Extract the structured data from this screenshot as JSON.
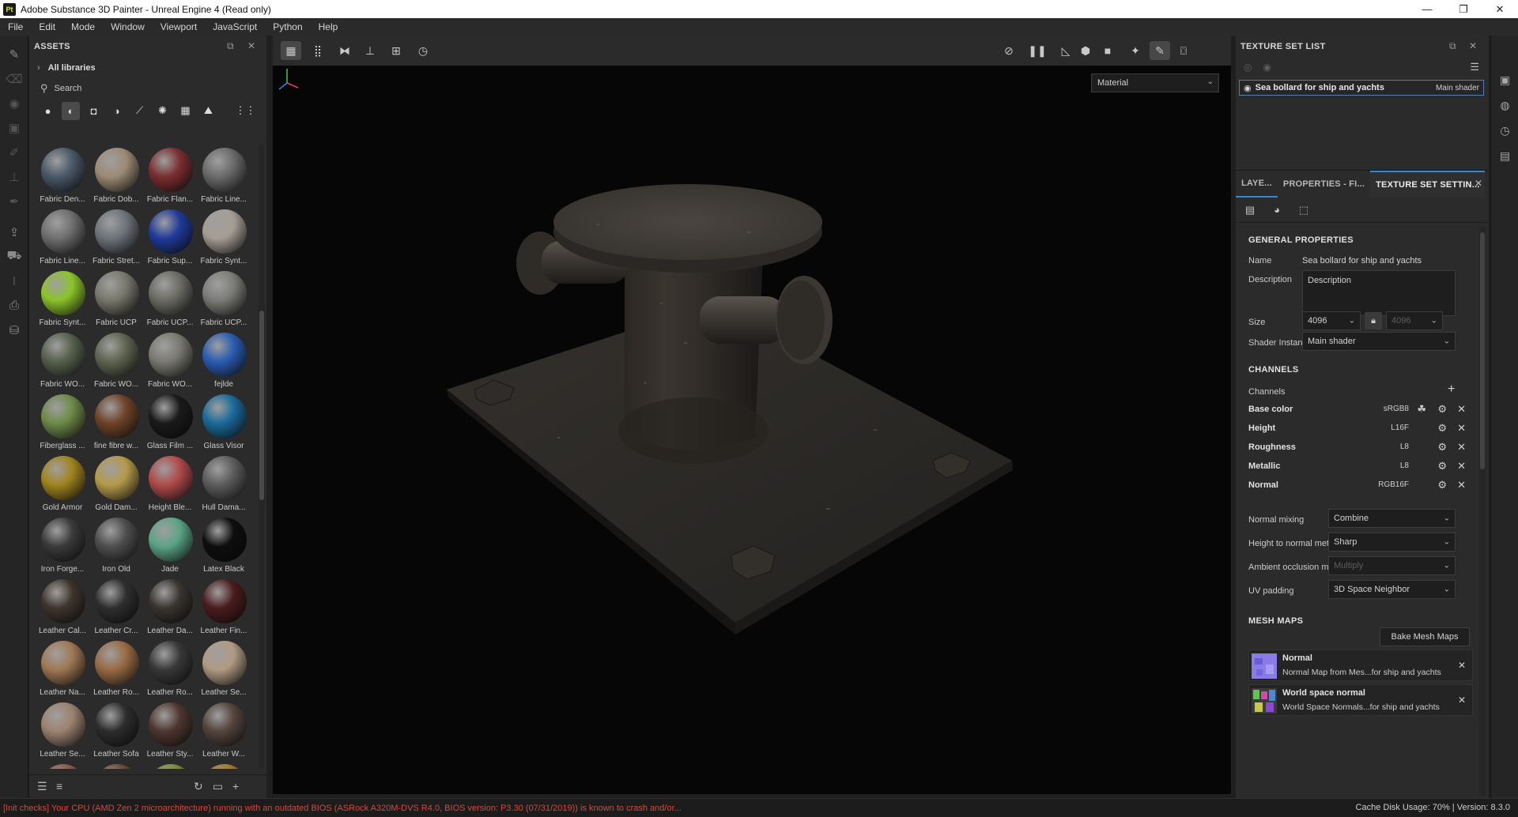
{
  "window": {
    "app_icon_text": "Pt",
    "title": "Adobe Substance 3D Painter - Unreal Engine 4 (Read only)",
    "controls": [
      "—",
      "❐",
      "✕"
    ]
  },
  "menu": [
    "File",
    "Edit",
    "Mode",
    "Window",
    "Viewport",
    "JavaScript",
    "Python",
    "Help"
  ],
  "assets": {
    "header": "ASSETS",
    "library": "All libraries",
    "search_placeholder": "Search",
    "tiles": [
      {
        "label": "Fabric Den...",
        "color": "#4a5868"
      },
      {
        "label": "Fabric Dob...",
        "color": "#9c8a74"
      },
      {
        "label": "Fabric Flan...",
        "color": "#7a2e30"
      },
      {
        "label": "Fabric Line...",
        "color": "#6a6a6a"
      },
      {
        "label": "Fabric Line...",
        "color": "#6f6f6f"
      },
      {
        "label": "Fabric Stret...",
        "color": "#6d737a"
      },
      {
        "label": "Fabric Sup...",
        "color": "#203a9a"
      },
      {
        "label": "Fabric Synt...",
        "color": "#a49d94"
      },
      {
        "label": "Fabric Synt...",
        "color": "#8bc42a"
      },
      {
        "label": "Fabric UCP",
        "color": "#78786c"
      },
      {
        "label": "Fabric UCP...",
        "color": "#6c6c64"
      },
      {
        "label": "Fabric UCP...",
        "color": "#7c7c78"
      },
      {
        "label": "Fabric WO...",
        "color": "#56604c"
      },
      {
        "label": "Fabric WO...",
        "color": "#5e6450"
      },
      {
        "label": "Fabric WO...",
        "color": "#7a7a72"
      },
      {
        "label": "fejlde",
        "color": "#2a5cb0"
      },
      {
        "label": "Fiberglass ...",
        "color": "#6e8a48"
      },
      {
        "label": "fine fibre w...",
        "color": "#6e4228"
      },
      {
        "label": "Glass Film ...",
        "color": "#1a1a1a"
      },
      {
        "label": "Glass Visor",
        "color": "#1a6a9a"
      },
      {
        "label": "Gold Armor",
        "color": "#a0841e"
      },
      {
        "label": "Gold Dam...",
        "color": "#b49a4a"
      },
      {
        "label": "Height Ble...",
        "color": "#b04a4a"
      },
      {
        "label": "Hull Dama...",
        "color": "#5c5c5c"
      },
      {
        "label": "Iron Forge...",
        "color": "#3a3a3a"
      },
      {
        "label": "Iron Old",
        "color": "#4e4e4e"
      },
      {
        "label": "Jade",
        "color": "#5aa486"
      },
      {
        "label": "Latex Black",
        "color": "#0e0e0e"
      },
      {
        "label": "Leather Cal...",
        "color": "#3e342c"
      },
      {
        "label": "Leather Cr...",
        "color": "#2e2e2e"
      },
      {
        "label": "Leather Da...",
        "color": "#383430"
      },
      {
        "label": "Leather Fin...",
        "color": "#4a1c1e"
      },
      {
        "label": "Leather Na...",
        "color": "#a07854"
      },
      {
        "label": "Leather Ro...",
        "color": "#986a44"
      },
      {
        "label": "Leather Ro...",
        "color": "#383838"
      },
      {
        "label": "Leather Se...",
        "color": "#b09a82"
      },
      {
        "label": "Leather Se...",
        "color": "#9c8270"
      },
      {
        "label": "Leather Sofa",
        "color": "#2c2c2c"
      },
      {
        "label": "Leather Sty...",
        "color": "#4e3630"
      },
      {
        "label": "Leather W...",
        "color": "#54443c"
      },
      {
        "label": "",
        "color": "#8a5a4a"
      },
      {
        "label": "",
        "color": "#6a4a3a"
      },
      {
        "label": "",
        "color": "#7a8a3a"
      },
      {
        "label": "",
        "color": "#a07a2a"
      }
    ]
  },
  "viewport": {
    "mode_select": "Material"
  },
  "texture_set_list": {
    "header": "TEXTURE SET LIST",
    "item_name": "Sea bollard for ship and yachts",
    "item_shader": "Main shader"
  },
  "properties": {
    "tabs": [
      "LAYE...",
      "PROPERTIES - FI...",
      "TEXTURE SET SETTIN..."
    ],
    "general_title": "GENERAL PROPERTIES",
    "name_label": "Name",
    "name_value": "Sea bollard for ship and yachts",
    "description_label": "Description",
    "description_value": "Description",
    "size_label": "Size",
    "size_value": "4096",
    "size_value_2": "4096",
    "shader_label": "Shader Instance",
    "shader_value": "Main shader",
    "channels_title": "CHANNELS",
    "channels_label": "Channels",
    "channels": [
      {
        "name": "Base color",
        "format": "sRGB8"
      },
      {
        "name": "Height",
        "format": "L16F"
      },
      {
        "name": "Roughness",
        "format": "L8"
      },
      {
        "name": "Metallic",
        "format": "L8"
      },
      {
        "name": "Normal",
        "format": "RGB16F"
      }
    ],
    "normal_mixing_label": "Normal mixing",
    "normal_mixing_value": "Combine",
    "height_normal_label": "Height to normal method",
    "height_normal_value": "Sharp",
    "ao_mixing_label": "Ambient occlusion mixing",
    "ao_mixing_value": "Multiply",
    "uv_padding_label": "UV padding",
    "uv_padding_value": "3D Space Neighbor",
    "mesh_maps_title": "MESH MAPS",
    "bake_button": "Bake Mesh Maps",
    "mesh_maps": [
      {
        "title": "Normal",
        "subtitle": "Normal Map from Mes...for ship and yachts"
      },
      {
        "title": "World space normal",
        "subtitle": "World Space Normals...for ship and yachts"
      }
    ]
  },
  "status": {
    "message": "[Init checks] Your CPU (AMD Zen 2 microarchitecture) running with an outdated BIOS (ASRock A320M-DVS R4.0, BIOS version: P3.30 (07/31/2019)) is known to crash and/or...",
    "cache": "Cache Disk Usage:   70% | Version: 8.3.0"
  }
}
